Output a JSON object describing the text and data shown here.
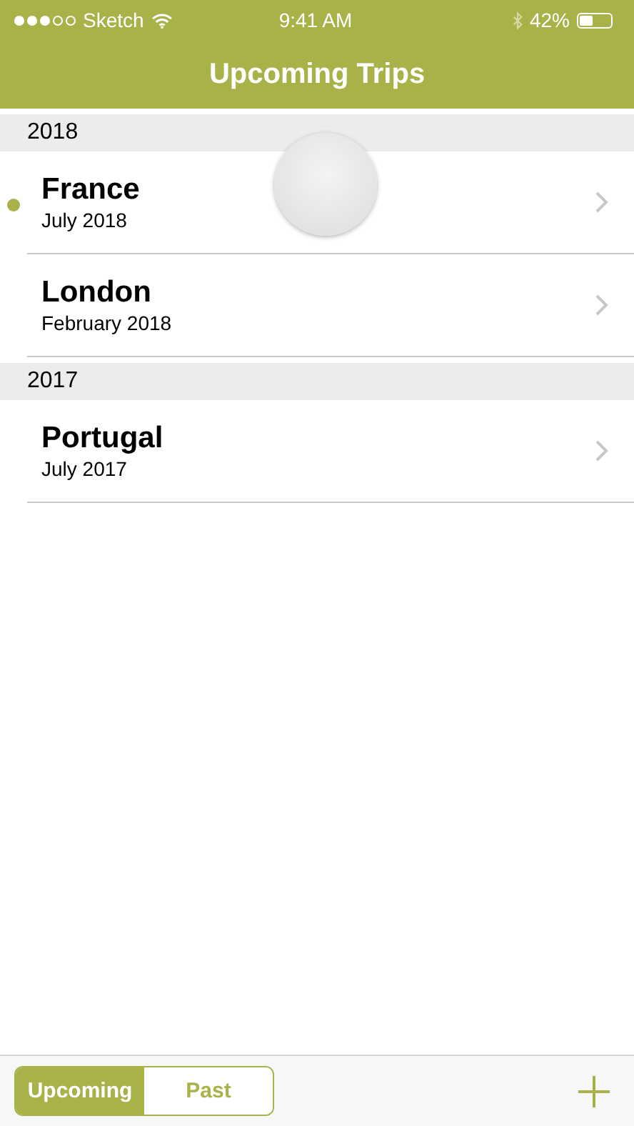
{
  "status_bar": {
    "carrier": "Sketch",
    "time": "9:41 AM",
    "battery_text": "42%"
  },
  "nav_bar": {
    "title": "Upcoming Trips"
  },
  "sections": [
    {
      "title": "2018",
      "trips": [
        {
          "name": "France",
          "date": "July 2018",
          "unread": true
        },
        {
          "name": "London",
          "date": "February 2018",
          "unread": false
        }
      ]
    },
    {
      "title": "2017",
      "trips": [
        {
          "name": "Portugal",
          "date": "July 2017",
          "unread": false
        }
      ]
    }
  ],
  "toolbar": {
    "segments": [
      {
        "label": "Upcoming",
        "selected": true
      },
      {
        "label": "Past",
        "selected": false
      }
    ]
  }
}
